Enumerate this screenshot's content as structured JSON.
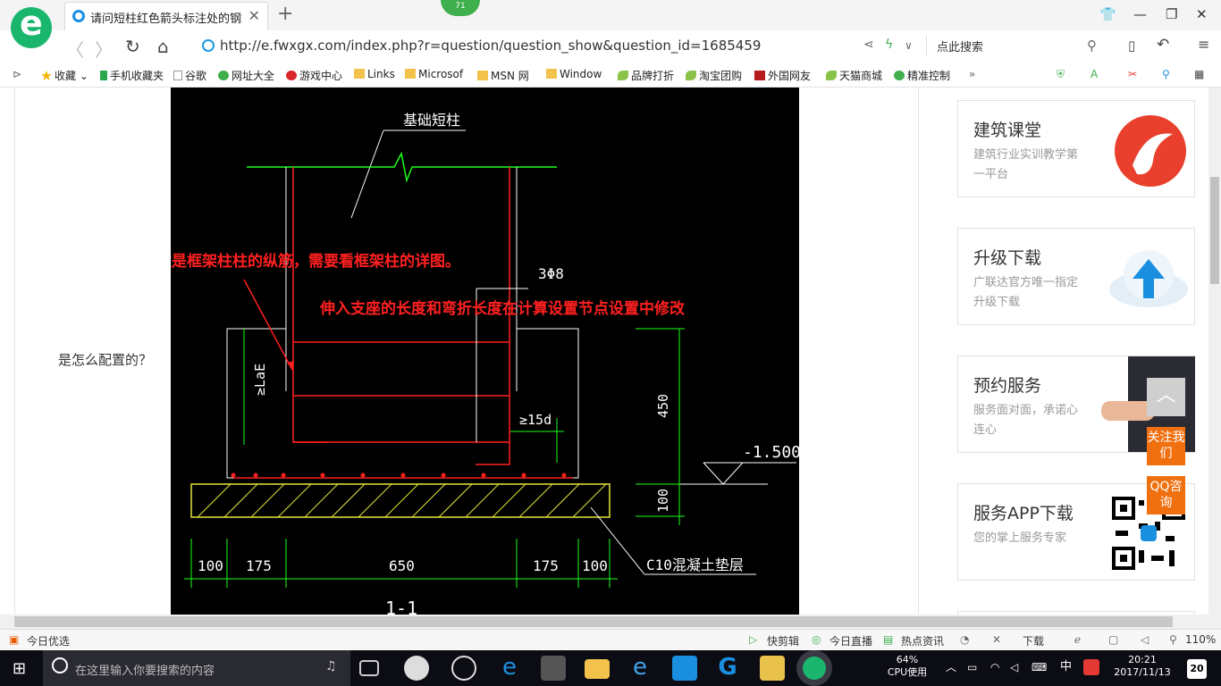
{
  "browser": {
    "tab_title": "请问短柱红色箭头标注处的钢筋是",
    "badge": "71",
    "url": "http://e.fwxgx.com/index.php?r=question/question_show&question_id=1685459",
    "search_placeholder": "点此搜索"
  },
  "bookmarks": [
    {
      "label": "收藏",
      "icon": "star-icon",
      "color": "#f5b400"
    },
    {
      "label": "手机收藏夹",
      "icon": "phone-icon",
      "color": "#2aa84a"
    },
    {
      "label": "谷歌",
      "icon": "page-icon",
      "color": "#999999"
    },
    {
      "label": "网址大全",
      "icon": "globe-icon",
      "color": "#3fae4c"
    },
    {
      "label": "游戏中心",
      "icon": "game-icon",
      "color": "#d9262c"
    },
    {
      "label": "Links",
      "icon": "folder-icon",
      "color": "#f3c24b"
    },
    {
      "label": "Microsof",
      "icon": "folder-icon",
      "color": "#f3c24b"
    },
    {
      "label": "MSN 网",
      "icon": "folder-icon",
      "color": "#f3c24b"
    },
    {
      "label": "Window",
      "icon": "folder-icon",
      "color": "#f3c24b"
    },
    {
      "label": "品牌打折",
      "icon": "leaf-icon",
      "color": "#8bc34a"
    },
    {
      "label": "淘宝团购",
      "icon": "leaf-icon",
      "color": "#8bc34a"
    },
    {
      "label": "外国网友",
      "icon": "bookmark-icon",
      "color": "#b71c1c"
    },
    {
      "label": "天猫商城",
      "icon": "leaf-icon",
      "color": "#8bc34a"
    },
    {
      "label": "精准控制",
      "icon": "wechat-icon",
      "color": "#3fae4c"
    }
  ],
  "question": {
    "text": "是怎么配置的？"
  },
  "cad": {
    "title": "基础短柱",
    "note1": "这是框架柱柱的纵筋，需要看框架柱的详图。",
    "note2": "伸入支座的长度和弯折长度在计算设置节点设置中修改",
    "rebar": "3Φ8",
    "lae": "≥LaE",
    "hook": "≥15d",
    "dim_height": "450",
    "dim_base": "100",
    "elevation": "-1.500",
    "dims_bottom": [
      "100",
      "175",
      "650",
      "175",
      "100"
    ],
    "concrete_label": "C10混凝土垫层",
    "section": "1-1"
  },
  "sidebar": [
    {
      "title": "建筑课堂",
      "subtitle": "建筑行业实训教学第一平台",
      "icon": "logo-icon"
    },
    {
      "title": "升级下载",
      "subtitle": "广联达官方唯一指定升级下载",
      "icon": "cloud-upload-icon"
    },
    {
      "title": "预约服务",
      "subtitle": "服务面对面，承诺心连心",
      "icon": "handshake-icon"
    },
    {
      "title": "服务APP下载",
      "subtitle": "您的掌上服务专家",
      "icon": "qr-code-icon"
    }
  ],
  "float_buttons": {
    "top": "︿",
    "follow": "关注我们",
    "qq": "QQ咨询"
  },
  "statusbar": {
    "left": "今日优选",
    "items": [
      "快剪辑",
      "今日直播",
      "热点资讯",
      "下载"
    ],
    "zoom": "110%"
  },
  "taskbar": {
    "search_placeholder": "在这里输入你要搜索的内容",
    "cpu_percent": "64%",
    "cpu_label": "CPU使用",
    "ime": "中",
    "time": "20:21",
    "date": "2017/11/13",
    "notifications": "20"
  }
}
